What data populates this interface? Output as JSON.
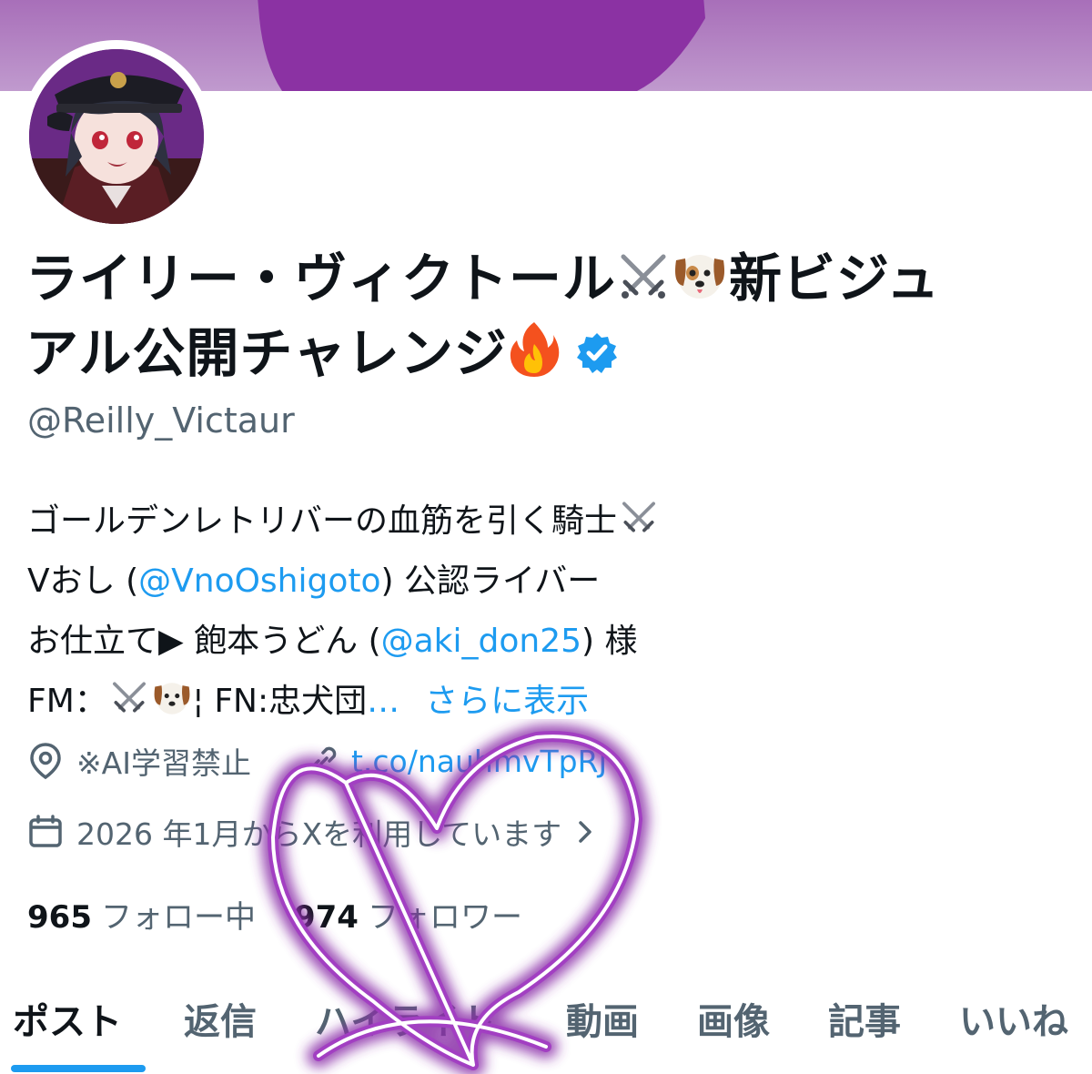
{
  "profile": {
    "name_line1": "ライリー・ヴィクトール",
    "name_line1_tail": "新ビジュ",
    "name_line2": "アル公開チャレンジ",
    "handle": "@Reilly_Victaur",
    "verified": true
  },
  "bio": {
    "line1": "ゴールデンレトリバーの血筋を引く騎士",
    "line2_prefix": "Vおし (",
    "line2_link": "@VnoOshigoto",
    "line2_suffix": ") 公認ライバー",
    "line3_prefix": "お仕立て▶ 飽本うどん (",
    "line3_link": "@aki_don25",
    "line3_suffix": ") 様",
    "line4_prefix": "FM：",
    "line4_mid": "¦ FN:忠犬団",
    "line4_ellipsis": "…",
    "show_more": "さらに表示"
  },
  "meta": {
    "location": "※AI学習禁止",
    "link": "t.co/nauhmvTpRJ",
    "joined": "2026 年1月からXを利用しています"
  },
  "stats": {
    "following_count": "965",
    "following_label": "フォロー中",
    "followers_count": "974",
    "followers_label": "フォロワー"
  },
  "tabs": [
    {
      "label": "ポスト",
      "active": true
    },
    {
      "label": "返信",
      "active": false
    },
    {
      "label": "ハイライト",
      "active": false
    },
    {
      "label": "動画",
      "active": false
    },
    {
      "label": "画像",
      "active": false
    },
    {
      "label": "記事",
      "active": false
    },
    {
      "label": "いいね",
      "active": false
    }
  ],
  "colors": {
    "accent": "#1d9bf0",
    "secondary_text": "#536471",
    "banner": "#a86fb9",
    "heart": "#8a2fa8"
  },
  "icons": {
    "swords": "crossed-swords-icon",
    "dog": "dog-face-icon",
    "fire": "fire-icon",
    "verified": "verified-badge-icon",
    "location": "location-pin-icon",
    "link": "link-icon",
    "calendar": "calendar-icon",
    "chevron": "chevron-right-icon"
  }
}
